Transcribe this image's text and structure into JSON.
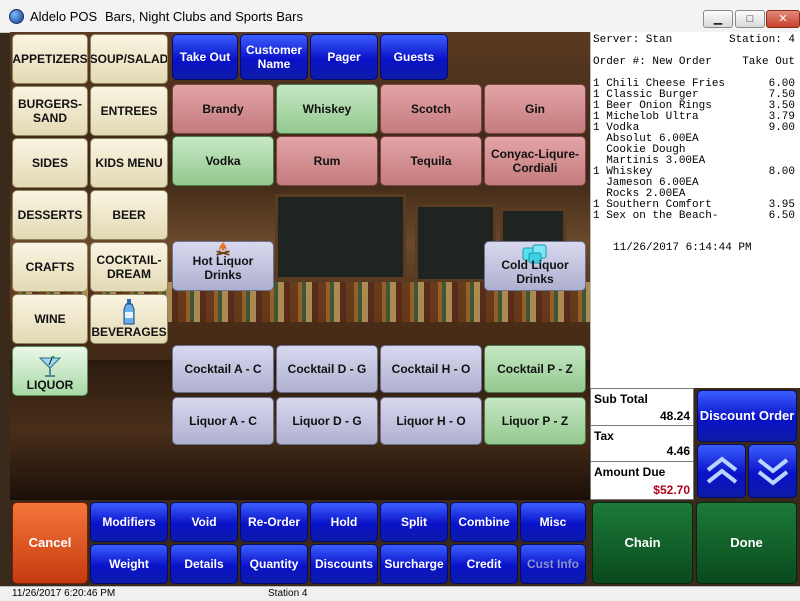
{
  "window": {
    "app_name": "Aldelo POS",
    "subtitle": "Bars, Night Clubs and Sports Bars",
    "minimize": "▁",
    "maximize": "□",
    "close": "✕"
  },
  "categories": [
    {
      "label": "APPETIZERS"
    },
    {
      "label": "SOUP/SALAD"
    },
    {
      "label": "BURGERS-SAND"
    },
    {
      "label": "ENTREES"
    },
    {
      "label": "SIDES"
    },
    {
      "label": "KIDS MENU"
    },
    {
      "label": "DESSERTS"
    },
    {
      "label": "BEER"
    },
    {
      "label": "CRAFTS"
    },
    {
      "label": "COCKTAIL-DREAM"
    },
    {
      "label": "WINE"
    },
    {
      "label": "BEVERAGES"
    },
    {
      "label": "LIQUOR"
    }
  ],
  "order_type": [
    "Take Out",
    "Customer Name",
    "Pager",
    "Guests"
  ],
  "liquors_row1": [
    "Brandy",
    "Whiskey",
    "Scotch",
    "Gin"
  ],
  "liquors_row2": [
    "Vodka",
    "Rum",
    "Tequila",
    "Conyac-Liqure-Cordiali"
  ],
  "special": {
    "hot": "Hot Liquor Drinks",
    "cold": "Cold Liquor Drinks"
  },
  "cocktails": [
    "Cocktail A - C",
    "Cocktail D - G",
    "Cocktail H - O",
    "Cocktail P - Z"
  ],
  "liquor_ranges": [
    "Liquor A - C",
    "Liquor D - G",
    "Liquor H - O",
    "Liquor P - Z"
  ],
  "actions_row1": [
    "Modifiers",
    "Void",
    "Re-Order",
    "Hold",
    "Split",
    "Combine",
    "Misc"
  ],
  "actions_row2": [
    "Weight",
    "Details",
    "Quantity",
    "Discounts",
    "Surcharge",
    "Credit",
    "Cust Info"
  ],
  "cancel": "Cancel",
  "chain": "Chain",
  "done": "Done",
  "discount_order": "Discount Order",
  "receipt": {
    "server": "Server: Stan",
    "station": "Station: 4",
    "order_no": "Order #: New Order",
    "order_type": "Take Out",
    "lines": [
      {
        "text": "1 Chili Cheese Fries",
        "price": "6.00"
      },
      {
        "text": "1 Classic Burger",
        "price": "7.50"
      },
      {
        "text": "1 Beer Onion Rings",
        "price": "3.50"
      },
      {
        "text": "1 Michelob Ultra",
        "price": "3.79"
      },
      {
        "text": "1 Vodka",
        "price": "9.00"
      },
      {
        "text": "  Absolut 6.00EA",
        "price": ""
      },
      {
        "text": "  Cookie Dough",
        "price": ""
      },
      {
        "text": "  Martinis 3.00EA",
        "price": ""
      },
      {
        "text": "1 Whiskey",
        "price": "8.00"
      },
      {
        "text": "  Jameson 6.00EA",
        "price": ""
      },
      {
        "text": "  Rocks 2.00EA",
        "price": ""
      },
      {
        "text": "1 Southern Comfort",
        "price": "3.95"
      },
      {
        "text": "1 Sex on the Beach-",
        "price": "6.50"
      }
    ],
    "timestamp": "11/26/2017 6:14:44 PM"
  },
  "totals": {
    "subtotal_label": "Sub Total",
    "subtotal": "48.24",
    "tax_label": "Tax",
    "tax": "4.46",
    "due_label": "Amount Due",
    "due": "$52.70",
    "due_color": "#b3001b"
  },
  "status": {
    "datetime": "11/26/2017 6:20:46 PM",
    "station": "Station 4"
  }
}
